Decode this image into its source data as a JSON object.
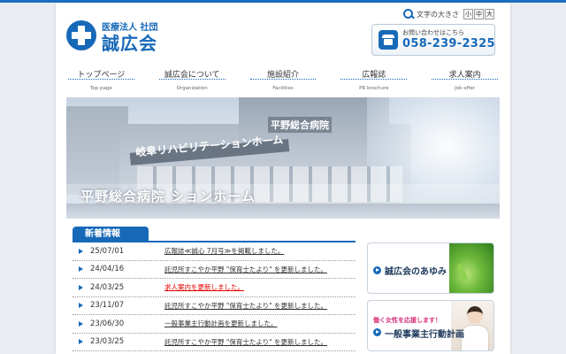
{
  "header": {
    "logo_sub": "医療法人 社団",
    "logo_name": "誠広会",
    "font_size_label": "文字の大きさ",
    "font_sizes": [
      "小",
      "中",
      "大"
    ],
    "contact_label": "お問い合わせはこちら",
    "contact_tel": "058-239-2325"
  },
  "nav": [
    {
      "jp": "トップページ",
      "en": "Top page"
    },
    {
      "jp": "誠広会について",
      "en": "Organization"
    },
    {
      "jp": "施設紹介",
      "en": "Facilities"
    },
    {
      "jp": "広報誌",
      "en": "PR brochure"
    },
    {
      "jp": "求人案内",
      "en": "Job offer"
    }
  ],
  "hero": {
    "sign_text": "岐阜リハビリテーションホーム",
    "roof_text": "平野総合病院",
    "caption": "平野総合病院 ションホーム"
  },
  "news": {
    "title": "新着情報",
    "items": [
      {
        "date": "25/07/01",
        "title": "広報誌≪誠心 7月号≫を掲載しました。",
        "highlight": false
      },
      {
        "date": "24/04/16",
        "title": "託児所すこやか平野 \"保育士たより\" を更新しました。",
        "highlight": false
      },
      {
        "date": "24/03/25",
        "title": "求人案内を更新しました。",
        "highlight": true
      },
      {
        "date": "23/11/07",
        "title": "託児所すこやか平野 \"保育士たより\" を更新しました。",
        "highlight": false
      },
      {
        "date": "23/06/30",
        "title": "一般事業主行動計画を更新しました。",
        "highlight": false
      },
      {
        "date": "23/03/25",
        "title": "託児所すこやか平野 \"保育士たより\" を更新しました。",
        "highlight": false
      }
    ]
  },
  "banners": {
    "history": "誠広会のあゆみ",
    "action_plan_small": "働く女性を応援します！",
    "action_plan": "一般事業主行動計画"
  },
  "colors": {
    "brand": "#1769b8",
    "highlight": "#e00000"
  }
}
